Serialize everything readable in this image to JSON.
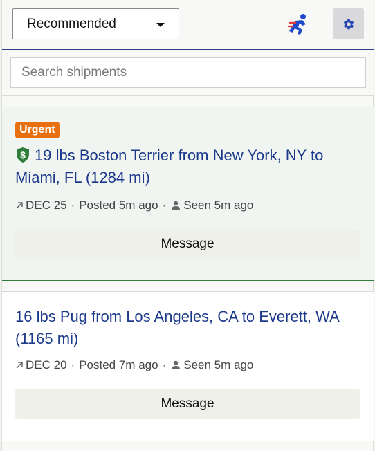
{
  "header": {
    "sort_value": "Recommended"
  },
  "search": {
    "placeholder": "Search shipments"
  },
  "shipments": [
    {
      "badge": "Urgent",
      "title": "19 lbs Boston Terrier from New York, NY to Miami, FL (1284 mi)",
      "date": "DEC 25",
      "posted": "Posted 5m ago",
      "seen": "Seen 5m ago",
      "message_label": "Message",
      "paid_icon": "dollar-shield-icon"
    },
    {
      "title": "16 lbs Pug from Los Angeles, CA to Everett, WA (1165 mi)",
      "date": "DEC 20",
      "posted": "Posted 7m ago",
      "seen": "Seen 5m ago",
      "message_label": "Message"
    }
  ],
  "colors": {
    "accent": "#1d3a8a",
    "urgent": "#e8700e",
    "shield": "#2f7d3a"
  }
}
